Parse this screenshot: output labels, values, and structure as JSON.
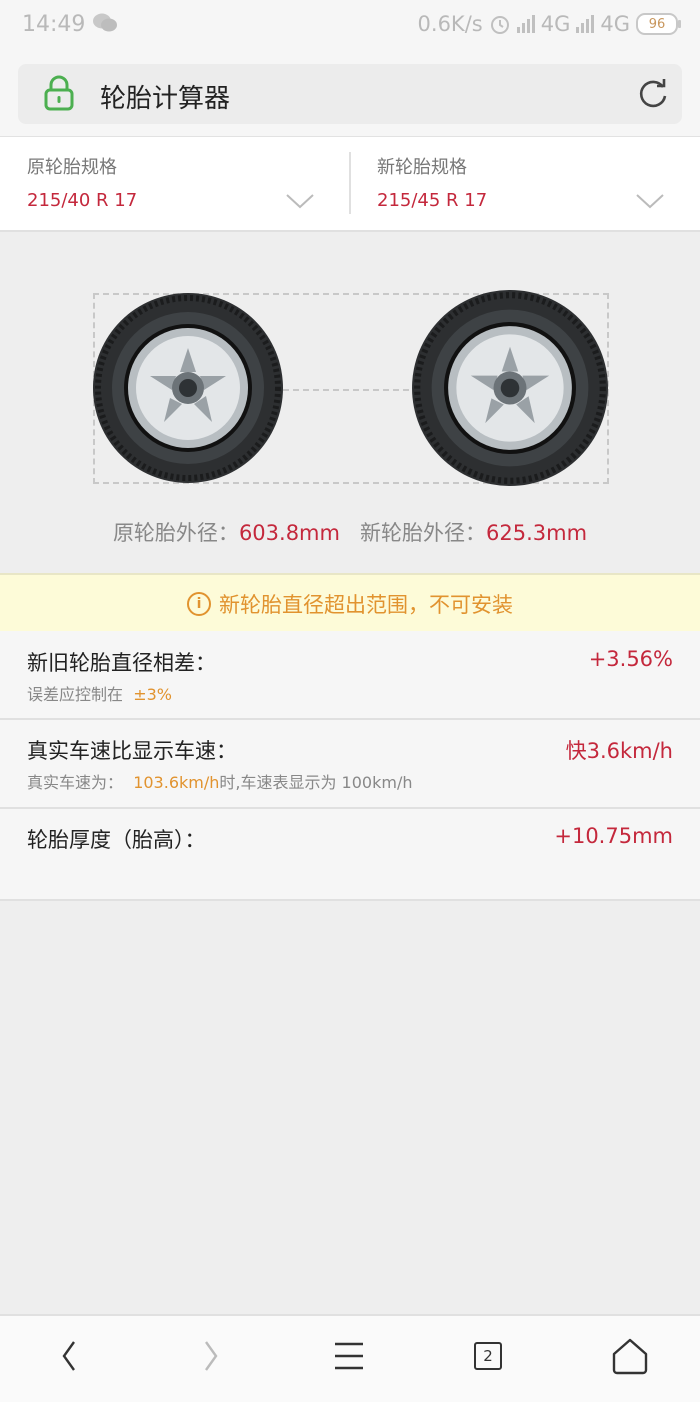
{
  "status": {
    "time": "14:49",
    "net_speed": "0.6K/s",
    "net1": "4G",
    "net2": "4G",
    "battery": "96"
  },
  "address": {
    "title": "轮胎计算器"
  },
  "specs": {
    "original": {
      "label": "原轮胎规格",
      "value": "215/40 R 17"
    },
    "new": {
      "label": "新轮胎规格",
      "value": "215/45 R 17"
    }
  },
  "diameters": {
    "original_label": "原轮胎外径：",
    "original_value": "603.8mm",
    "new_label": "新轮胎外径：",
    "new_value": "625.3mm"
  },
  "warning": {
    "icon": "info-icon",
    "text": "新轮胎直径超出范围，不可安装"
  },
  "results": {
    "diff": {
      "label": "新旧轮胎直径相差：",
      "value": "+3.56%",
      "sub_prefix": "误差应控制在",
      "sub_highlight": "±3%"
    },
    "speed": {
      "label": "真实车速比显示车速：",
      "value": "快3.6km/h",
      "sub_prefix": "真实车速为：",
      "sub_highlight": "103.6km/h",
      "sub_suffix": "时,车速表显示为 100km/h"
    },
    "thickness": {
      "label": "轮胎厚度（胎高）：",
      "value": "+10.75mm"
    }
  },
  "nav": {
    "tab_count": "2"
  },
  "colors": {
    "accent": "#c4283c",
    "warning": "#e1932f",
    "lock": "#4caf50"
  }
}
